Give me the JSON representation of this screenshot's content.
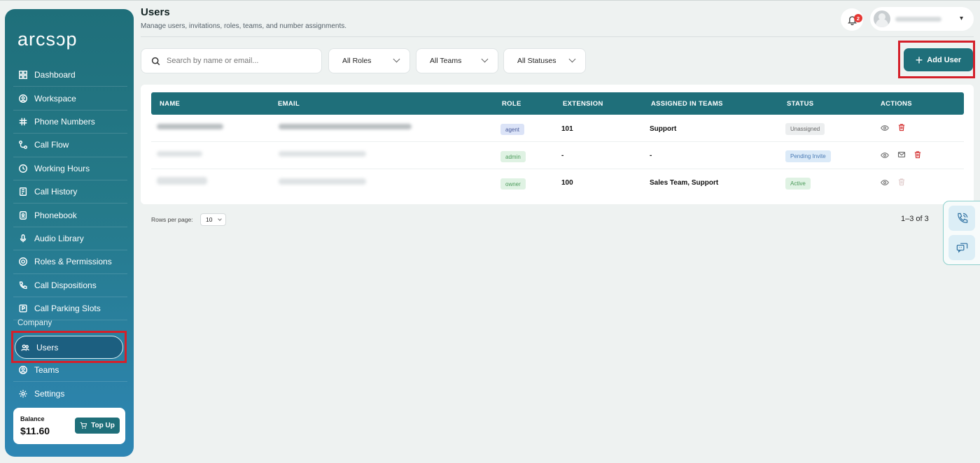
{
  "app": {
    "logo": "arcsɔp"
  },
  "sidebar": {
    "items": [
      {
        "label": "Dashboard",
        "icon": "grid-icon"
      },
      {
        "label": "Workspace",
        "icon": "workspace-icon"
      },
      {
        "label": "Phone Numbers",
        "icon": "hash-icon"
      },
      {
        "label": "Call Flow",
        "icon": "flow-icon"
      },
      {
        "label": "Working Hours",
        "icon": "clock-icon"
      },
      {
        "label": "Call History",
        "icon": "history-icon"
      },
      {
        "label": "Phonebook",
        "icon": "phonebook-icon"
      },
      {
        "label": "Audio Library",
        "icon": "mic-icon"
      },
      {
        "label": "Roles & Permissions",
        "icon": "shield-icon"
      },
      {
        "label": "Call Dispositions",
        "icon": "phone-icon"
      },
      {
        "label": "Call Parking Slots",
        "icon": "parking-icon"
      }
    ],
    "section_company": "Company",
    "company_items": [
      {
        "label": "Users",
        "icon": "users-icon",
        "active": true
      },
      {
        "label": "Teams",
        "icon": "teams-icon"
      },
      {
        "label": "Settings",
        "icon": "gear-icon"
      }
    ],
    "balance": {
      "label": "Balance",
      "value": "$11.60",
      "topup_label": "Top Up"
    }
  },
  "header": {
    "title": "Users",
    "subtitle": "Manage users, invitations, roles, teams, and number assignments.",
    "notifications_count": "2"
  },
  "filters": {
    "search_placeholder": "Search by name or email...",
    "roles": "All Roles",
    "teams": "All Teams",
    "statuses": "All Statuses",
    "add_user": "Add User"
  },
  "table": {
    "columns": [
      "NAME",
      "EMAIL",
      "ROLE",
      "EXTENSION",
      "ASSIGNED IN TEAMS",
      "STATUS",
      "ACTIONS"
    ],
    "rows": [
      {
        "role": "agent",
        "extension": "101",
        "teams": "Support",
        "status": "Unassigned"
      },
      {
        "role": "admin",
        "extension": "-",
        "teams": "-",
        "status": "Pending Invite"
      },
      {
        "role": "owner",
        "extension": "100",
        "teams": "Sales Team, Support",
        "status": "Active"
      }
    ]
  },
  "pagination": {
    "rows_label": "Rows per page:",
    "rows_value": "10",
    "range": "1–3 of 3"
  },
  "colors": {
    "brand": "#1f6f7a",
    "highlight": "#d4202a",
    "danger": "#d32f2f"
  }
}
